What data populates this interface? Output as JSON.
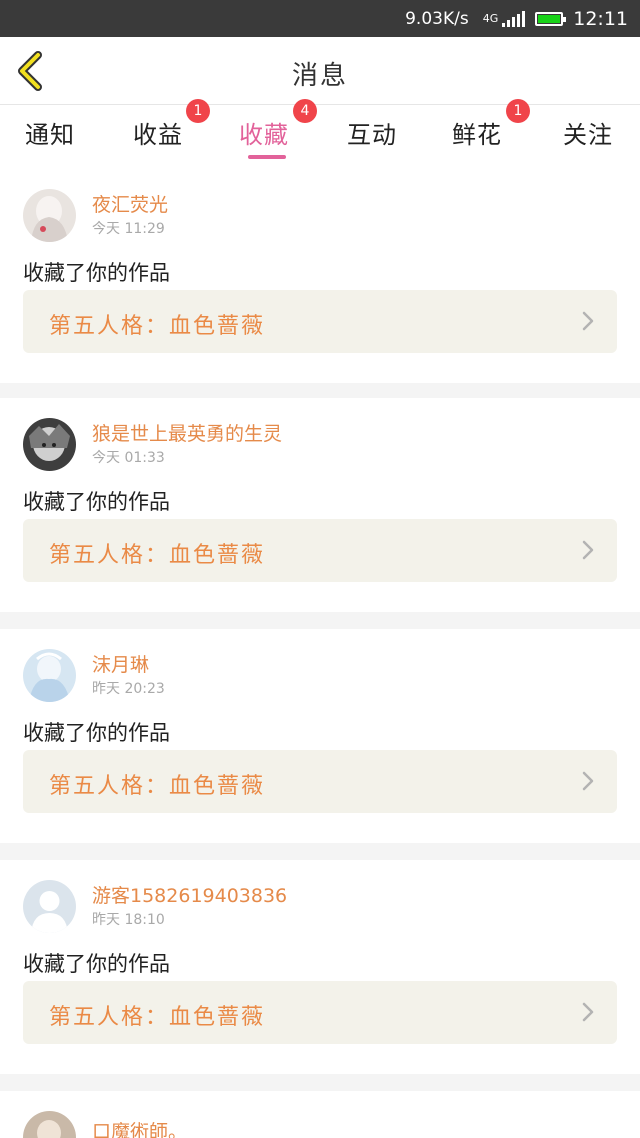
{
  "status_bar": {
    "speed": "9.03K/s",
    "network": "4G",
    "time": "12:11",
    "battery_color": "#19d219"
  },
  "header": {
    "title": "消息",
    "back_icon": "chevron-left-icon"
  },
  "tabs": [
    {
      "label": "通知",
      "badge": ""
    },
    {
      "label": "收益",
      "badge": "1"
    },
    {
      "label": "收藏",
      "badge": "4",
      "active": true
    },
    {
      "label": "互动",
      "badge": ""
    },
    {
      "label": "鲜花",
      "badge": "1"
    },
    {
      "label": "关注",
      "badge": ""
    }
  ],
  "accent_color": "#e2629a",
  "messages": [
    {
      "username": "夜汇荧光",
      "time": "今天 11:29",
      "action": "收藏了你的作品",
      "work": "第五人格：血色蔷薇"
    },
    {
      "username": "狼是世上最英勇的生灵",
      "time": "今天 01:33",
      "action": "收藏了你的作品",
      "work": "第五人格：血色蔷薇"
    },
    {
      "username": "沫月琳",
      "time": "昨天 20:23",
      "action": "收藏了你的作品",
      "work": "第五人格：血色蔷薇"
    },
    {
      "username": "游客1582619403836",
      "time": "昨天 18:10",
      "action": "收藏了你的作品",
      "work": "第五人格：血色蔷薇"
    },
    {
      "username": "口魔術師。",
      "time": "",
      "action": "",
      "work": ""
    }
  ]
}
